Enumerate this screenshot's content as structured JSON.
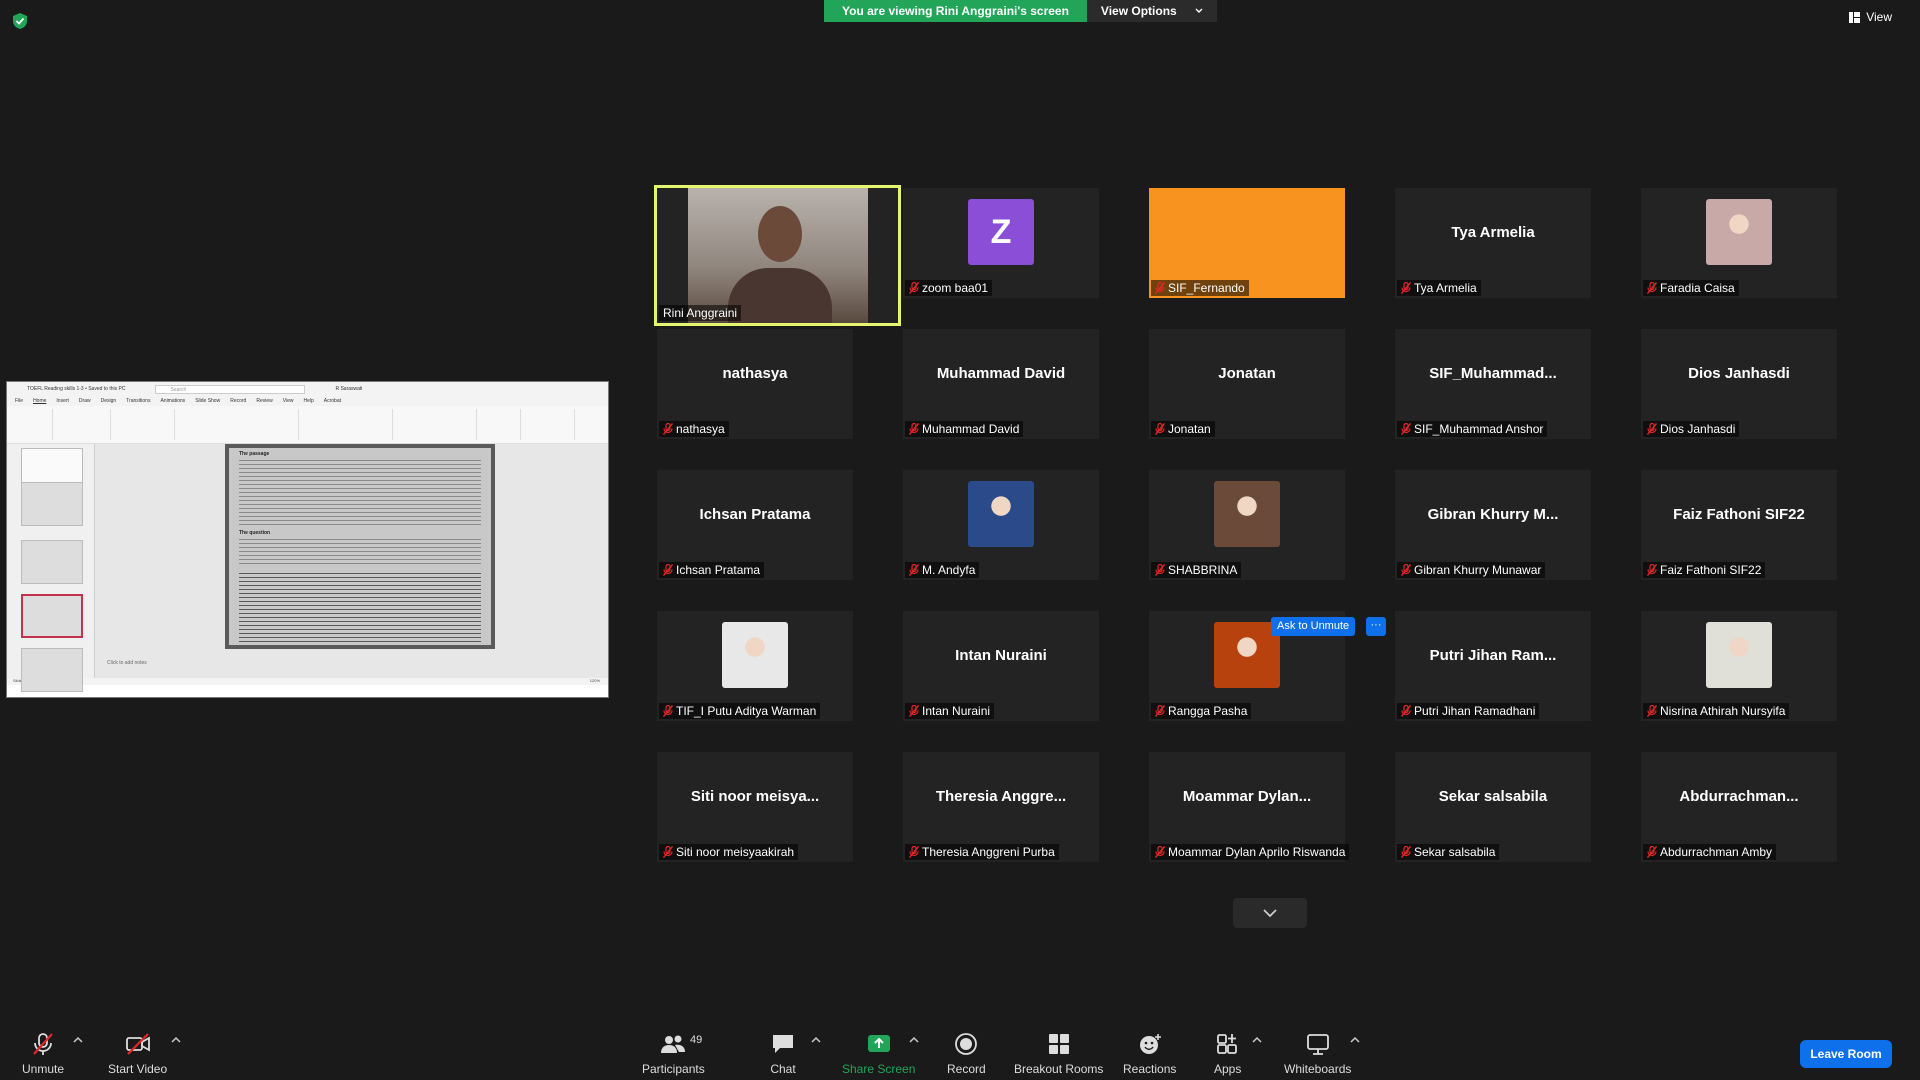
{
  "banner": {
    "message": "You are viewing Rini Anggraini's screen",
    "view_options": "View Options"
  },
  "view_button": "View",
  "shared_screen": {
    "ppt_title": "TOEFL Reading skills 1-3 • Saved to this PC",
    "search_placeholder": "Search",
    "user": "R Saraswati",
    "tabs": [
      "File",
      "Home",
      "Insert",
      "Draw",
      "Design",
      "Transitions",
      "Animations",
      "Slide Show",
      "Record",
      "Review",
      "View",
      "Help",
      "Acrobat"
    ],
    "share": "Share",
    "notes_placeholder": "Click to add notes",
    "status": "Slide 5 of 13",
    "zoom": "120%",
    "slide_heading": "The passage",
    "slide_question_heading": "The question"
  },
  "participants": [
    {
      "name": "Rini Anggraini",
      "display": "",
      "type": "video",
      "active": true,
      "muted": false
    },
    {
      "name": "zoom baa01",
      "display": "Z",
      "type": "letter",
      "color": "#8a4fd6",
      "muted": true
    },
    {
      "name": "SIF_Fernando",
      "display": "",
      "type": "orange",
      "color": "#f7931e",
      "muted": true
    },
    {
      "name": "Tya Armelia",
      "display": "Tya Armelia",
      "type": "text",
      "muted": true
    },
    {
      "name": "Faradia Caisa",
      "display": "",
      "type": "photo",
      "color": "#c9a8a8",
      "muted": true
    },
    {
      "name": "nathasya",
      "display": "nathasya",
      "type": "text",
      "muted": true
    },
    {
      "name": "Muhammad David",
      "display": "Muhammad David",
      "type": "text",
      "muted": true
    },
    {
      "name": "Jonatan",
      "display": "Jonatan",
      "type": "text",
      "muted": true
    },
    {
      "name": "SIF_Muhammad Anshor",
      "display": "SIF_Muhammad...",
      "type": "text",
      "muted": true
    },
    {
      "name": "Dios Janhasdi",
      "display": "Dios Janhasdi",
      "type": "text",
      "muted": true
    },
    {
      "name": "Ichsan Pratama",
      "display": "Ichsan Pratama",
      "type": "text",
      "muted": true
    },
    {
      "name": "M. Andyfa",
      "display": "",
      "type": "photo",
      "color": "#2a4a8a",
      "muted": true
    },
    {
      "name": "SHABBRINA",
      "display": "",
      "type": "photo",
      "color": "#6b4a3a",
      "muted": true
    },
    {
      "name": "Gibran Khurry Munawar",
      "display": "Gibran Khurry M...",
      "type": "text",
      "muted": true
    },
    {
      "name": "Faiz Fathoni SIF22",
      "display": "Faiz Fathoni SIF22",
      "type": "text",
      "muted": true
    },
    {
      "name": "TIF_I Putu Aditya Warman",
      "display": "",
      "type": "photo",
      "color": "#e8e8e8",
      "muted": true
    },
    {
      "name": "Intan Nuraini",
      "display": "Intan Nuraini",
      "type": "text",
      "muted": true
    },
    {
      "name": "Rangga Pasha",
      "display": "",
      "type": "photo",
      "color": "#b8420e",
      "muted": true
    },
    {
      "name": "Putri Jihan Ramadhani",
      "display": "Putri Jihan Ram...",
      "type": "text",
      "muted": true
    },
    {
      "name": "Nisrina Athirah Nursyifa",
      "display": "",
      "type": "photo",
      "color": "#e0e0d8",
      "muted": true
    },
    {
      "name": "Siti noor meisyaakirah",
      "display": "Siti noor meisya...",
      "type": "text",
      "muted": true
    },
    {
      "name": "Theresia Anggreni Purba",
      "display": "Theresia Anggre...",
      "type": "text",
      "muted": true
    },
    {
      "name": "Moammar Dylan Aprilo Riswanda",
      "display": "Moammar  Dylan...",
      "type": "text",
      "muted": true
    },
    {
      "name": "Sekar salsabila",
      "display": "Sekar salsabila",
      "type": "text",
      "muted": true
    },
    {
      "name": "Abdurrachman Amby",
      "display": "Abdurrachman...",
      "type": "text",
      "muted": true
    }
  ],
  "ask_to_unmute": "Ask to Unmute",
  "more_label": "···",
  "toolbar": {
    "unmute": "Unmute",
    "start_video": "Start Video",
    "participants": "Participants",
    "participants_count": "49",
    "chat": "Chat",
    "share_screen": "Share Screen",
    "record": "Record",
    "breakout_rooms": "Breakout Rooms",
    "reactions": "Reactions",
    "apps": "Apps",
    "whiteboards": "Whiteboards",
    "leave_room": "Leave Room"
  },
  "colors": {
    "active_border": "#e5f570",
    "banner_green": "#23a559",
    "share_green": "#23a559",
    "accent_blue": "#0e71eb",
    "muted_red": "#e02828"
  }
}
